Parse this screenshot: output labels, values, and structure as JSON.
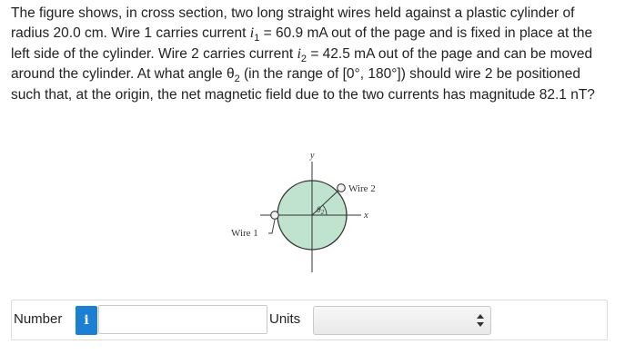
{
  "problem": {
    "p1": "The figure shows, in cross section, two long straight wires held against a plastic cylinder of radius 20.0 cm. Wire 1 carries current ",
    "i1_sym": "i",
    "i1_sub": "1",
    "p2": " = 60.9 mA out of the page and is fixed in place at the left side of the cylinder. Wire 2 carries current ",
    "i2_sym": "i",
    "i2_sub": "2",
    "p3": " = 42.5 mA out of the page and can be moved around the cylinder. At what angle θ",
    "theta_sub": "2",
    "p4": " (in the range of [0°, 180°]) should wire 2 be positioned such that, at the origin, the net magnetic field due to the two currents has magnitude 82.1 nT?"
  },
  "figure": {
    "y_label": "y",
    "x_label": "x",
    "wire1_label": "Wire 1",
    "wire2_label": "Wire 2",
    "theta_symbol": "θ",
    "theta_sub": "2",
    "cylinder_color": "#bfe3cf"
  },
  "answer": {
    "number_label": "Number",
    "info_icon_text": "i",
    "number_value": "",
    "units_label": "Units",
    "units_value": ""
  },
  "colors": {
    "info_button": "#1b7fd3"
  }
}
